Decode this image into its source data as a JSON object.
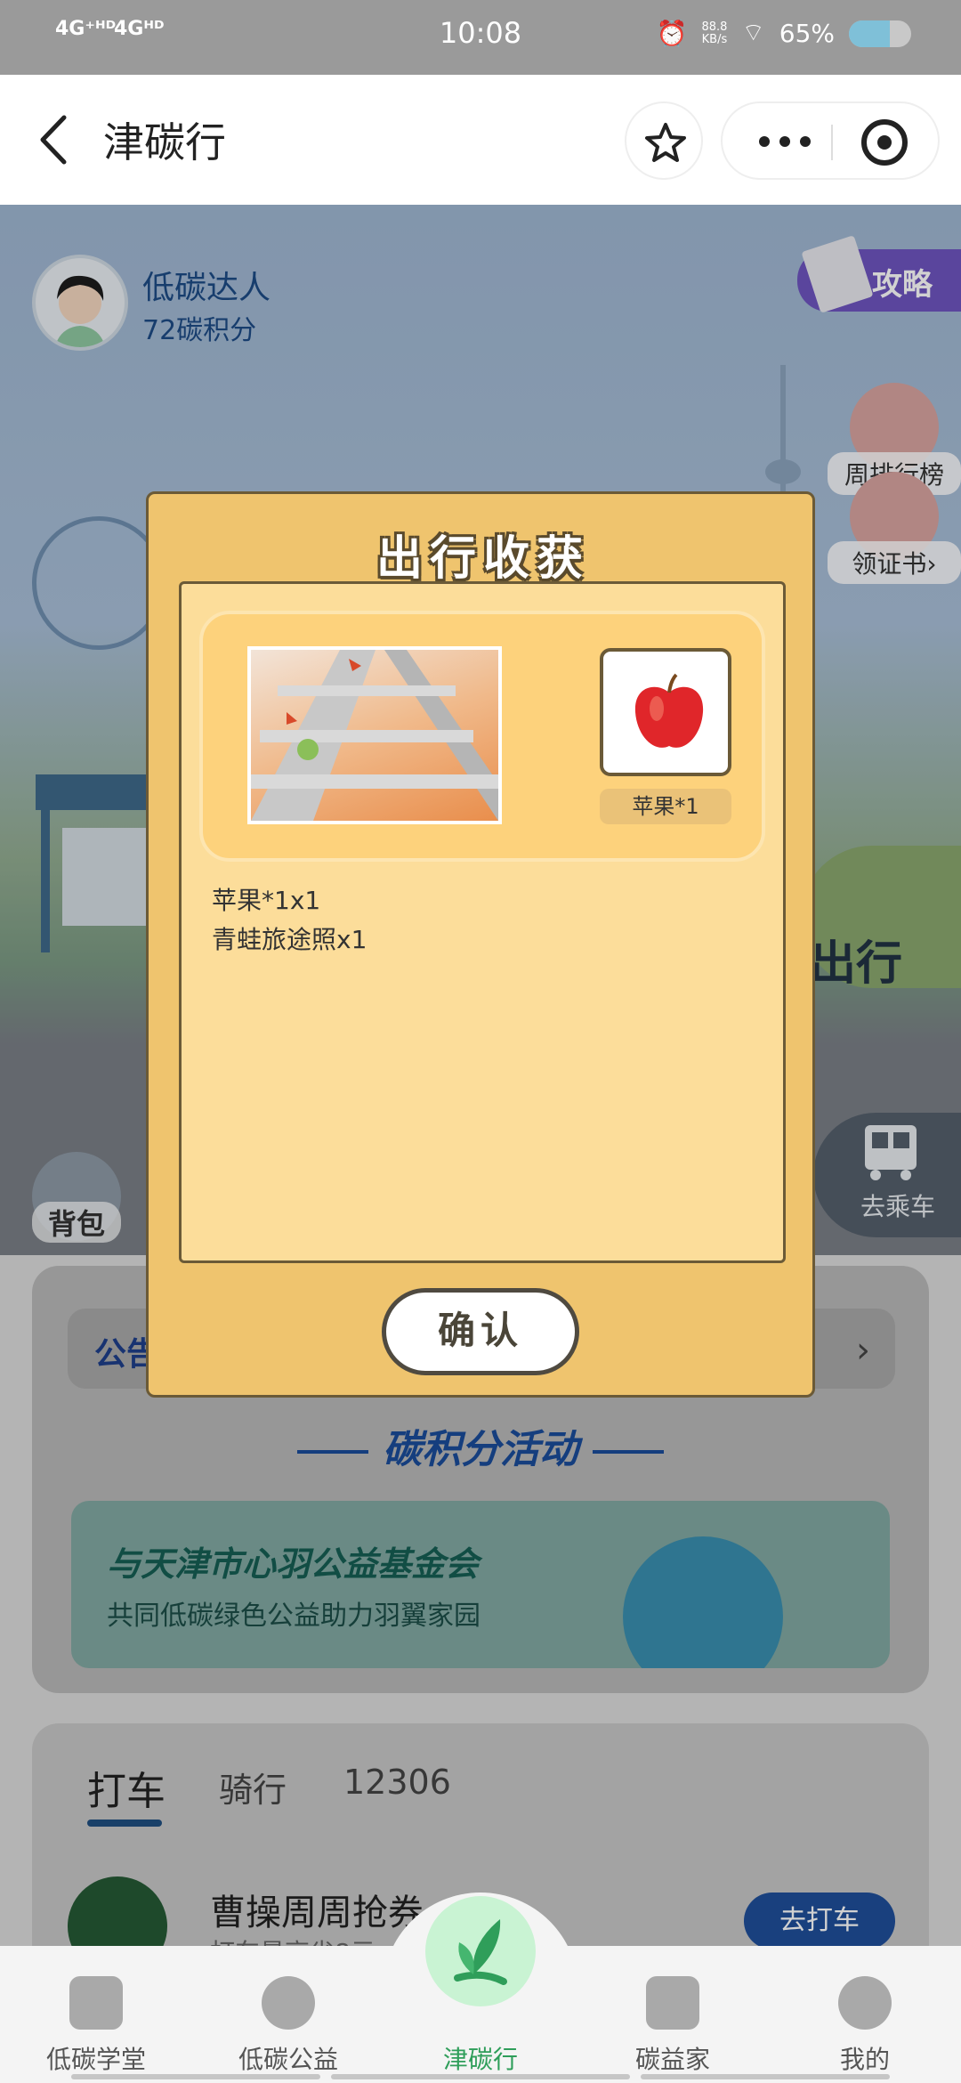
{
  "status_bar": {
    "sig1": "4G⁺ᴴᴰ",
    "sig2": "4Gᴴᴰ",
    "time": "10:08",
    "net_speed": "88.8\nKB/s",
    "battery_pct": "65%",
    "battery_level": 0.65
  },
  "header": {
    "title": "津碳行"
  },
  "profile": {
    "name": "低碳达人",
    "points": "72碳积分"
  },
  "scene": {
    "guide_label": "攻略",
    "rank_label": "周排行榜",
    "cert_label": "领证书›",
    "travel_label": "出行",
    "bus_label": "去乘车",
    "bag_label": "背包"
  },
  "activity": {
    "notice_label": "公告",
    "section_title": "碳积分活动",
    "banner_line1": "与天津市心羽公益基金会",
    "banner_line2": "共同低碳绿色公益助力羽翼家园"
  },
  "rides": {
    "tabs": [
      "打车",
      "骑行",
      "12306"
    ],
    "coupon_title": "曹操周周抢券",
    "coupon_sub": "打车最高省8元",
    "button": "去打车"
  },
  "modal": {
    "title": "出行收获",
    "item_label": "苹果*1",
    "rewards": [
      "苹果*1x1",
      "青蛙旅途照x1"
    ],
    "confirm": "确认"
  },
  "tabbar": {
    "items": [
      "低碳学堂",
      "低碳公益",
      "津碳行",
      "碳益家",
      "我的"
    ],
    "active": "津碳行"
  },
  "colors": {
    "accent_green": "#2f9e5a",
    "modal_bg": "#efc46e",
    "title_blue": "#1a4c9a"
  }
}
